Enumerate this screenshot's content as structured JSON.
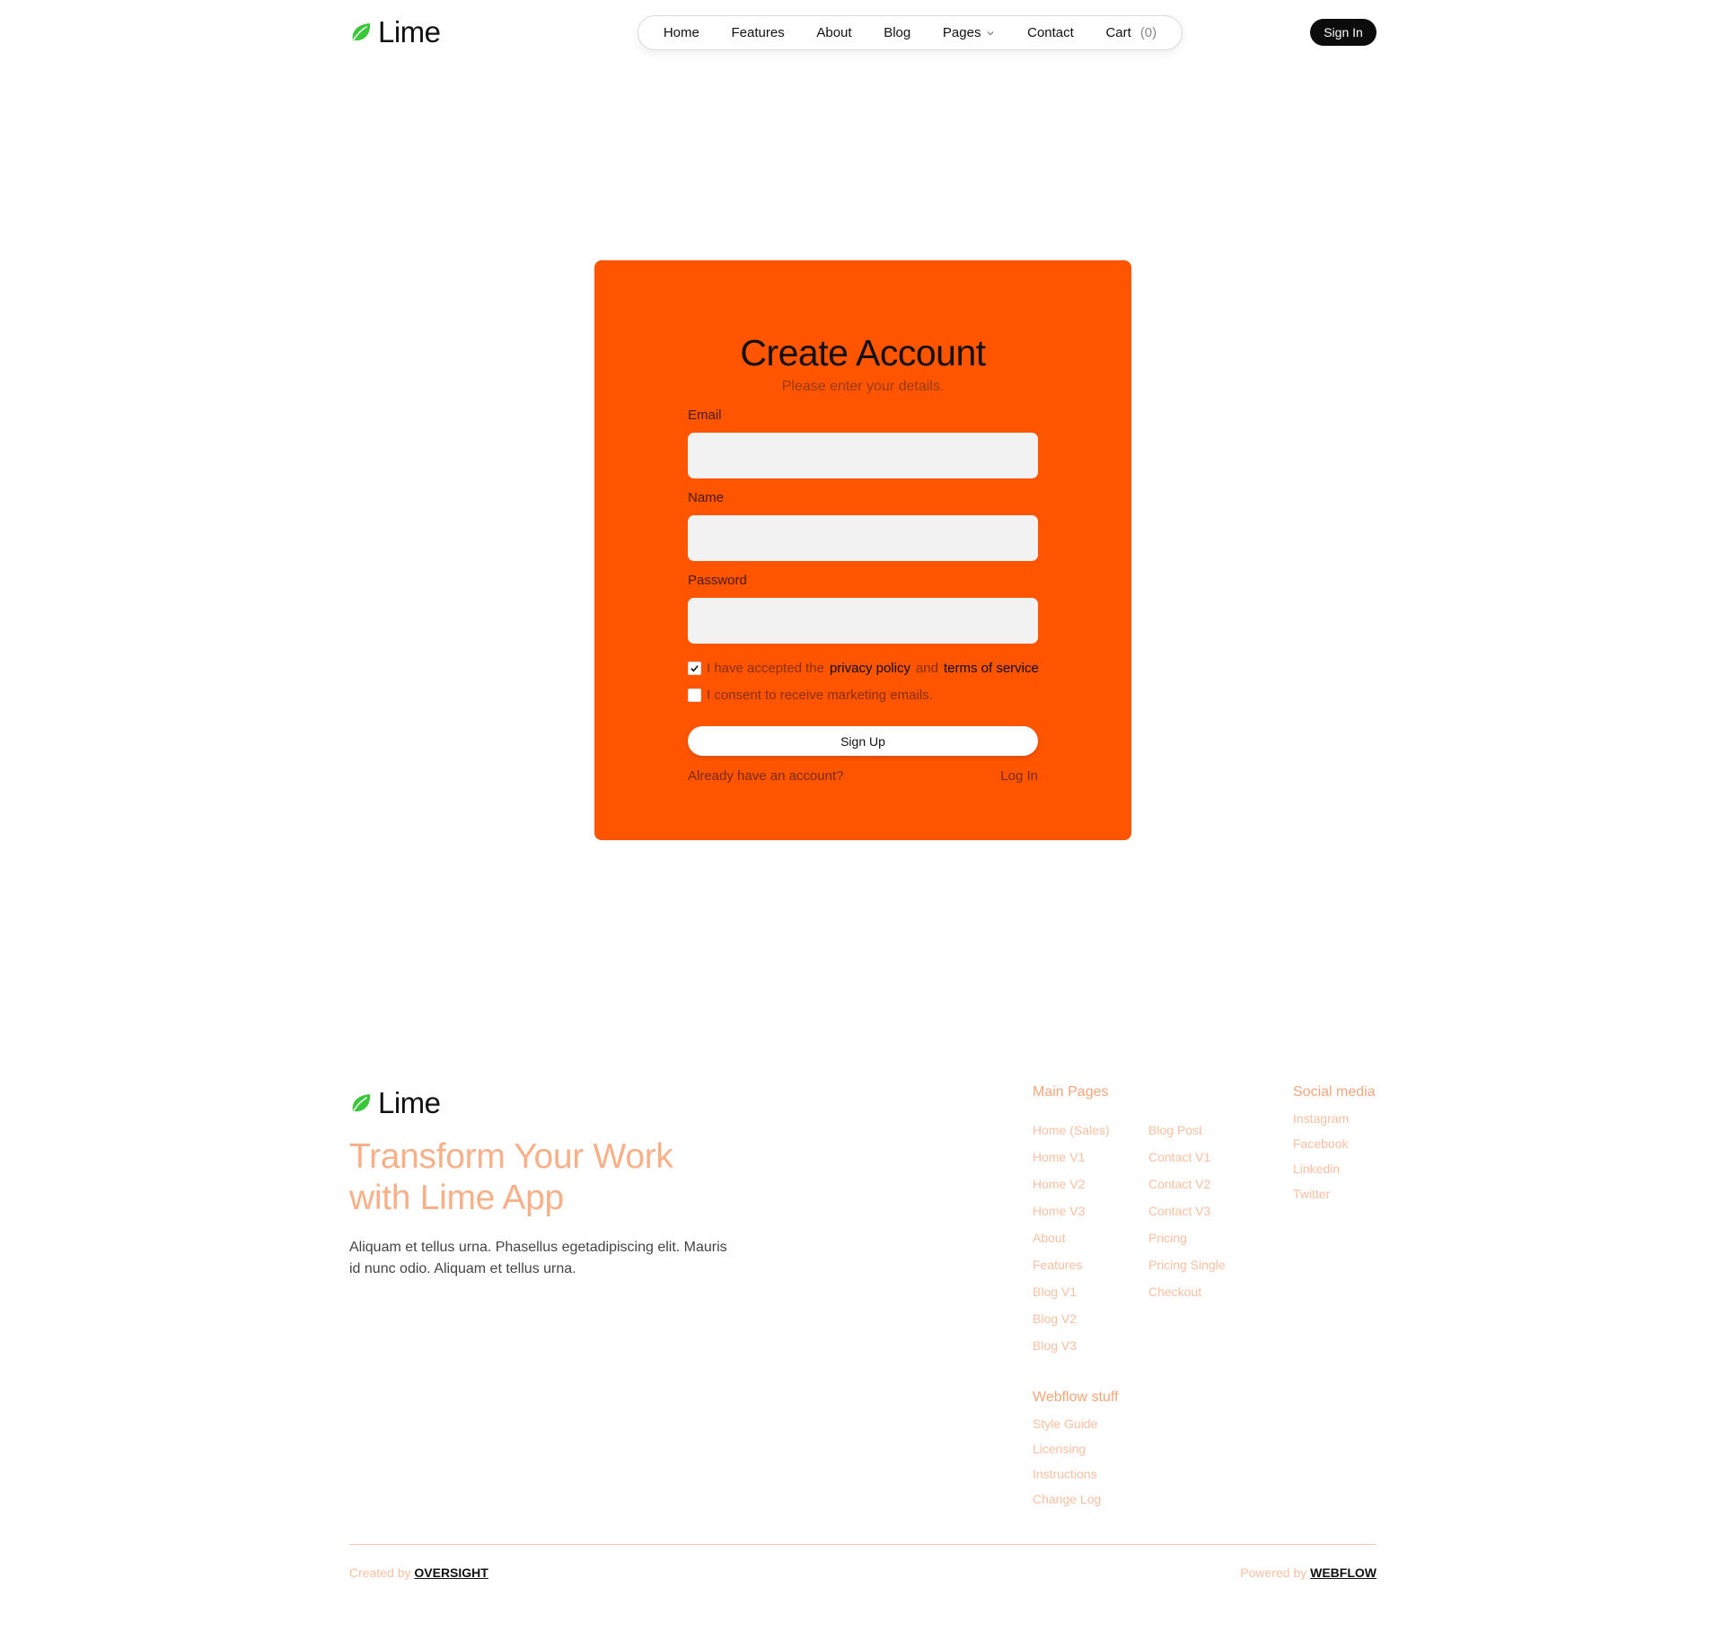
{
  "header": {
    "logo_text": "Lime",
    "nav": {
      "home": "Home",
      "features": "Features",
      "about": "About",
      "blog": "Blog",
      "pages": "Pages",
      "contact": "Contact",
      "cart": "Cart",
      "cart_count": "(0)"
    },
    "signin_label": "Sign In"
  },
  "form": {
    "title": "Create Account",
    "subtitle": "Please enter your details.",
    "email_label": "Email",
    "email_value": "",
    "name_label": "Name",
    "name_value": "",
    "password_label": "Password",
    "password_value": "",
    "privacy_checked": true,
    "privacy_prefix": "I have accepted the",
    "privacy_link": "privacy policy",
    "privacy_and": "and",
    "terms_link": "terms of service",
    "marketing_checked": false,
    "marketing_text": "I consent to receive marketing emails.",
    "submit_label": "Sign Up",
    "already_text": "Already have an account?",
    "login_label": "Log In"
  },
  "footer": {
    "logo_text": "Lime",
    "tagline": "Transform Your Work with Lime App",
    "blurb": "Aliquam et tellus urna. Phasellus egetadipiscing elit. Mauris id nunc odio. Aliquam et tellus urna.",
    "main_pages_heading": "Main Pages",
    "main_pages_col1": [
      "Home (Sales)",
      "Home V1",
      "Home V2",
      "Home V3",
      "About",
      "Features",
      "Blog V1",
      "Blog V2",
      "Blog V3"
    ],
    "main_pages_col2": [
      "Blog Post",
      "Contact V1",
      "Contact V2",
      "Contact V3",
      "Pricing",
      "Pricing Single",
      "Checkout"
    ],
    "social_heading": "Social media",
    "social_links": [
      "Instagram",
      "Facebook",
      "Linkedin",
      "Twitter"
    ],
    "webflow_heading": "Webflow stuff",
    "webflow_links": [
      "Style Guide",
      "Licensing",
      "Instructions",
      "Change Log"
    ],
    "created_prefix": "Created by",
    "created_brand": "OVERSIGHT",
    "powered_prefix": "Powered by",
    "powered_brand": "WEBFLOW"
  },
  "colors": {
    "accent": "#ff5500",
    "logo_green": "#3ac83a",
    "footer_peach": "#f8b089"
  },
  "icons": {
    "logo": "leaf-icon",
    "pages_dropdown": "chevron-down-icon",
    "checkbox_checked": "check-icon"
  }
}
